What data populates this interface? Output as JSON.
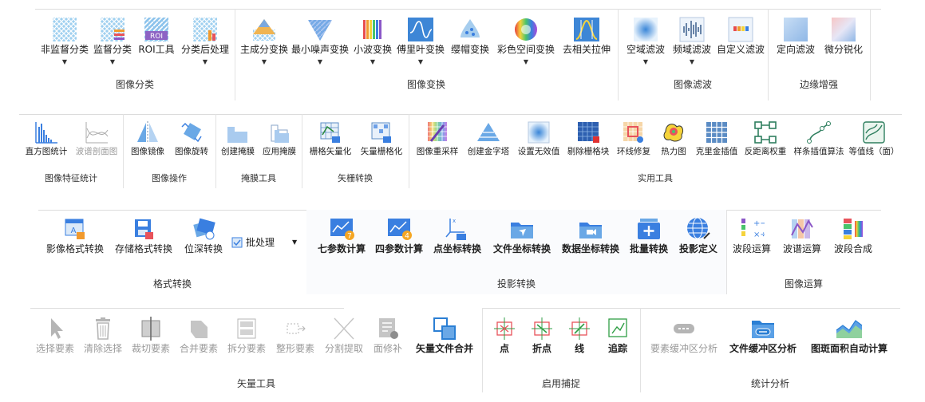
{
  "row1": {
    "groups": [
      {
        "label": "图像分类",
        "tools": [
          {
            "label": "非监督分类",
            "icon": "unsupervised-classification-icon",
            "dropdown": true
          },
          {
            "label": "监督分类",
            "icon": "supervised-classification-icon",
            "dropdown": true
          },
          {
            "label": "ROI工具",
            "icon": "roi-tool-icon",
            "dropdown": false,
            "icon_text": "ROI"
          },
          {
            "label": "分类后处理",
            "icon": "post-classification-icon",
            "dropdown": true
          }
        ]
      },
      {
        "label": "图像变换",
        "tools": [
          {
            "label": "主成分变换",
            "icon": "pca-icon",
            "dropdown": true
          },
          {
            "label": "最小噪声变换",
            "icon": "mnf-icon",
            "dropdown": true
          },
          {
            "label": "小波变换",
            "icon": "wavelet-icon",
            "dropdown": true
          },
          {
            "label": "傅里叶变换",
            "icon": "fourier-icon",
            "dropdown": true
          },
          {
            "label": "缨帽变换",
            "icon": "tasseled-cap-icon",
            "dropdown": false
          },
          {
            "label": "彩色空间变换",
            "icon": "color-space-icon",
            "dropdown": true
          },
          {
            "label": "去相关拉伸",
            "icon": "decorrelation-stretch-icon",
            "dropdown": false
          }
        ]
      },
      {
        "label": "图像滤波",
        "tools": [
          {
            "label": "空域滤波",
            "icon": "spatial-filter-icon",
            "dropdown": true
          },
          {
            "label": "频域滤波",
            "icon": "frequency-filter-icon",
            "dropdown": true
          },
          {
            "label": "自定义滤波",
            "icon": "custom-filter-icon",
            "dropdown": false
          }
        ]
      },
      {
        "label": "边缘增强",
        "tools": [
          {
            "label": "定向滤波",
            "icon": "directional-filter-icon",
            "dropdown": false
          },
          {
            "label": "微分锐化",
            "icon": "differential-sharpen-icon",
            "dropdown": false
          }
        ]
      }
    ]
  },
  "row2": {
    "groups": [
      {
        "label": "图像特征统计",
        "tools": [
          {
            "label": "直方图统计",
            "icon": "histogram-icon"
          },
          {
            "label": "波谱剖面图",
            "icon": "spectral-profile-icon",
            "disabled": true
          }
        ]
      },
      {
        "label": "图像操作",
        "tools": [
          {
            "label": "图像镜像",
            "icon": "mirror-icon"
          },
          {
            "label": "图像旋转",
            "icon": "rotate-icon"
          }
        ]
      },
      {
        "label": "掩膜工具",
        "tools": [
          {
            "label": "创建掩膜",
            "icon": "create-mask-icon"
          },
          {
            "label": "应用掩膜",
            "icon": "apply-mask-icon"
          }
        ]
      },
      {
        "label": "矢栅转换",
        "tools": [
          {
            "label": "栅格矢量化",
            "icon": "raster-to-vector-icon"
          },
          {
            "label": "矢量栅格化",
            "icon": "vector-to-raster-icon"
          }
        ]
      },
      {
        "label": "实用工具",
        "tools": [
          {
            "label": "图像重采样",
            "icon": "resample-icon"
          },
          {
            "label": "创建金字塔",
            "icon": "pyramid-icon"
          },
          {
            "label": "设置无效值",
            "icon": "nodata-icon"
          },
          {
            "label": "剔除栅格块",
            "icon": "remove-tiles-icon"
          },
          {
            "label": "环线修复",
            "icon": "ring-repair-icon"
          },
          {
            "label": "热力图",
            "icon": "heatmap-icon"
          },
          {
            "label": "克里金插值",
            "icon": "kriging-icon"
          },
          {
            "label": "反距离权重",
            "icon": "idw-icon"
          },
          {
            "label": "样条插值算法",
            "icon": "spline-icon"
          },
          {
            "label": "等值线（面）",
            "icon": "contour-icon"
          }
        ]
      }
    ]
  },
  "row3": {
    "groups": [
      {
        "label": "格式转换",
        "tools": [
          {
            "label": "影像格式转换",
            "icon": "image-format-convert-icon"
          },
          {
            "label": "存储格式转换",
            "icon": "storage-format-convert-icon"
          },
          {
            "label": "位深转换",
            "icon": "bit-depth-icon"
          }
        ],
        "batch_label": "批处理"
      },
      {
        "label": "投影转换",
        "tools": [
          {
            "label": "七参数计算",
            "icon": "seven-param-icon",
            "badge": "7"
          },
          {
            "label": "四参数计算",
            "icon": "four-param-icon",
            "badge": "4"
          },
          {
            "label": "点坐标转换",
            "icon": "point-coord-convert-icon"
          },
          {
            "label": "文件坐标转换",
            "icon": "file-coord-convert-icon"
          },
          {
            "label": "数据坐标转换",
            "icon": "data-coord-convert-icon"
          },
          {
            "label": "批量转换",
            "icon": "batch-convert-icon"
          },
          {
            "label": "投影定义",
            "icon": "projection-define-icon"
          }
        ]
      },
      {
        "label": "图像运算",
        "tools": [
          {
            "label": "波段运算",
            "icon": "band-math-icon"
          },
          {
            "label": "波谱运算",
            "icon": "spectral-math-icon"
          },
          {
            "label": "波段合成",
            "icon": "band-composite-icon"
          }
        ]
      }
    ]
  },
  "row4": {
    "groups": [
      {
        "label": "矢量工具",
        "tools": [
          {
            "label": "选择要素",
            "icon": "select-feature-icon",
            "disabled": true
          },
          {
            "label": "清除选择",
            "icon": "clear-selection-icon",
            "disabled": true
          },
          {
            "label": "裁切要素",
            "icon": "clip-feature-icon",
            "disabled": true
          },
          {
            "label": "合并要素",
            "icon": "merge-feature-icon",
            "disabled": true
          },
          {
            "label": "拆分要素",
            "icon": "split-feature-icon",
            "disabled": true
          },
          {
            "label": "整形要素",
            "icon": "reshape-feature-icon",
            "disabled": true
          },
          {
            "label": "分割提取",
            "icon": "split-extract-icon",
            "disabled": true
          },
          {
            "label": "面修补",
            "icon": "polygon-repair-icon",
            "disabled": true
          },
          {
            "label": "矢量文件合并",
            "icon": "vector-merge-icon"
          }
        ]
      },
      {
        "label": "启用捕捉",
        "tools": [
          {
            "label": "点",
            "icon": "snap-point-icon"
          },
          {
            "label": "折点",
            "icon": "snap-vertex-icon"
          },
          {
            "label": "线",
            "icon": "snap-line-icon"
          },
          {
            "label": "追踪",
            "icon": "trace-icon"
          }
        ]
      },
      {
        "label": "统计分析",
        "tools": [
          {
            "label": "要素缓冲区分析",
            "icon": "feature-buffer-icon",
            "disabled": true
          },
          {
            "label": "文件缓冲区分析",
            "icon": "file-buffer-icon"
          },
          {
            "label": "图斑面积自动计算",
            "icon": "area-calc-icon"
          }
        ]
      }
    ]
  },
  "colors": {
    "accent": "#2b7fd4",
    "disabled": "#9a9a9a",
    "divider": "#dcdcdc"
  }
}
